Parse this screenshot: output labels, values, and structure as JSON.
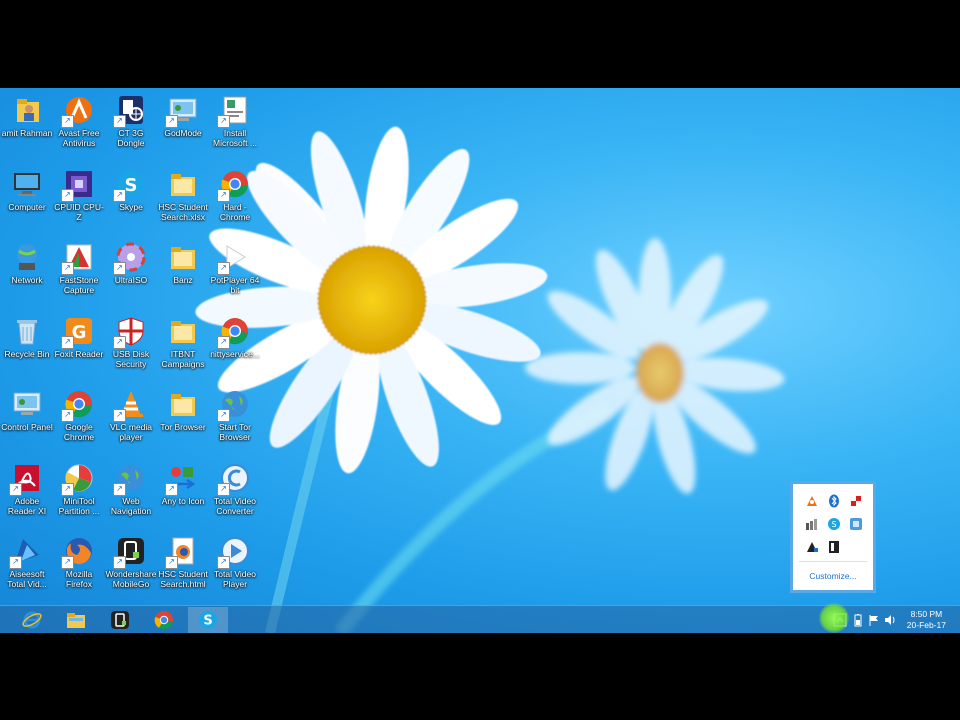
{
  "desktop_icons": [
    {
      "label": "amit Rahman",
      "icon": "user-folder-icon"
    },
    {
      "label": "Avast Free Antivirus",
      "icon": "avast-icon"
    },
    {
      "label": "CT 3G Dongle",
      "icon": "dongle-icon"
    },
    {
      "label": "GodMode",
      "icon": "control-panel-icon"
    },
    {
      "label": "Install Microsoft ...",
      "icon": "installer-icon"
    },
    {
      "label": "Computer",
      "icon": "computer-icon"
    },
    {
      "label": "CPUID CPU-Z",
      "icon": "cpuz-icon"
    },
    {
      "label": "Skype",
      "icon": "skype-icon"
    },
    {
      "label": "HSC Student Search.xlsx",
      "icon": "folder-icon"
    },
    {
      "label": "Hard - Chrome",
      "icon": "chrome-icon"
    },
    {
      "label": "Network",
      "icon": "network-icon"
    },
    {
      "label": "FastStone Capture",
      "icon": "faststone-icon"
    },
    {
      "label": "UltraISO",
      "icon": "disc-icon"
    },
    {
      "label": "Banz",
      "icon": "folder-icon"
    },
    {
      "label": "PotPlayer 64 bit",
      "icon": "potplayer-icon"
    },
    {
      "label": "Recycle Bin",
      "icon": "recycle-bin-icon"
    },
    {
      "label": "Foxit Reader",
      "icon": "foxit-icon"
    },
    {
      "label": "USB Disk Security",
      "icon": "shield-icon"
    },
    {
      "label": "ITBNT Campaigns",
      "icon": "folder-icon"
    },
    {
      "label": "nittyservice...",
      "icon": "chrome-icon"
    },
    {
      "label": "Control Panel",
      "icon": "control-panel-icon"
    },
    {
      "label": "Google Chrome",
      "icon": "chrome-icon"
    },
    {
      "label": "VLC media player",
      "icon": "vlc-icon"
    },
    {
      "label": "Tor Browser",
      "icon": "folder-icon"
    },
    {
      "label": "Start Tor Browser",
      "icon": "globe-icon"
    },
    {
      "label": "Adobe Reader XI",
      "icon": "adobe-reader-icon"
    },
    {
      "label": "MiniTool Partition ...",
      "icon": "minitool-icon"
    },
    {
      "label": "Web Navigation",
      "icon": "globe-icon"
    },
    {
      "label": "Any to Icon",
      "icon": "any-to-icon-icon"
    },
    {
      "label": "Total Video Converter",
      "icon": "video-converter-icon"
    },
    {
      "label": "Aiseesoft Total Vid...",
      "icon": "aiseesoft-icon"
    },
    {
      "label": "Mozilla Firefox",
      "icon": "firefox-icon"
    },
    {
      "label": "Wondershare MobileGo",
      "icon": "mobilego-icon"
    },
    {
      "label": "HSC Student Search.html",
      "icon": "firefox-doc-icon"
    },
    {
      "label": "Total Video Player",
      "icon": "video-player-icon"
    }
  ],
  "taskbar": {
    "pinned": [
      {
        "name": "internet-explorer",
        "icon": "ie-icon"
      },
      {
        "name": "file-explorer",
        "icon": "file-explorer-icon"
      },
      {
        "name": "wondershare",
        "icon": "mobilego-icon"
      },
      {
        "name": "chrome",
        "icon": "chrome-icon"
      },
      {
        "name": "skype",
        "icon": "skype-icon",
        "active": true
      }
    ],
    "clock_time": "8:50 PM",
    "clock_date": "20-Feb-17"
  },
  "tray_overflow": {
    "icons": [
      "avast-tray-icon",
      "bluetooth-icon",
      "usb-security-tray-icon",
      "network-meter-icon",
      "skype-tray-icon",
      "any-to-icon-tray-icon",
      "notify-icon",
      "flash-icon"
    ],
    "customize_label": "Customize..."
  },
  "colors": {
    "wallpaper": "#2aa6f0",
    "taskbar": "#2a6aa0",
    "overflow_border": "#5aa8e6",
    "highlight": "#8ff050"
  }
}
